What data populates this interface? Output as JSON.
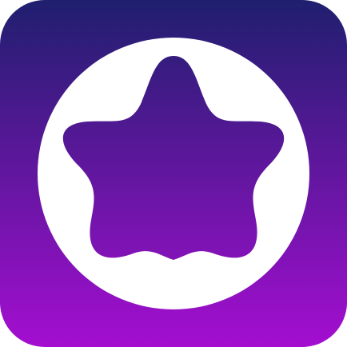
{
  "icon": {
    "name": "star-in-circle-app-icon",
    "colors": {
      "gradient_top": "#1F1F6E",
      "gradient_bottom": "#A40ED0",
      "circle": "#FFFFFF"
    }
  }
}
